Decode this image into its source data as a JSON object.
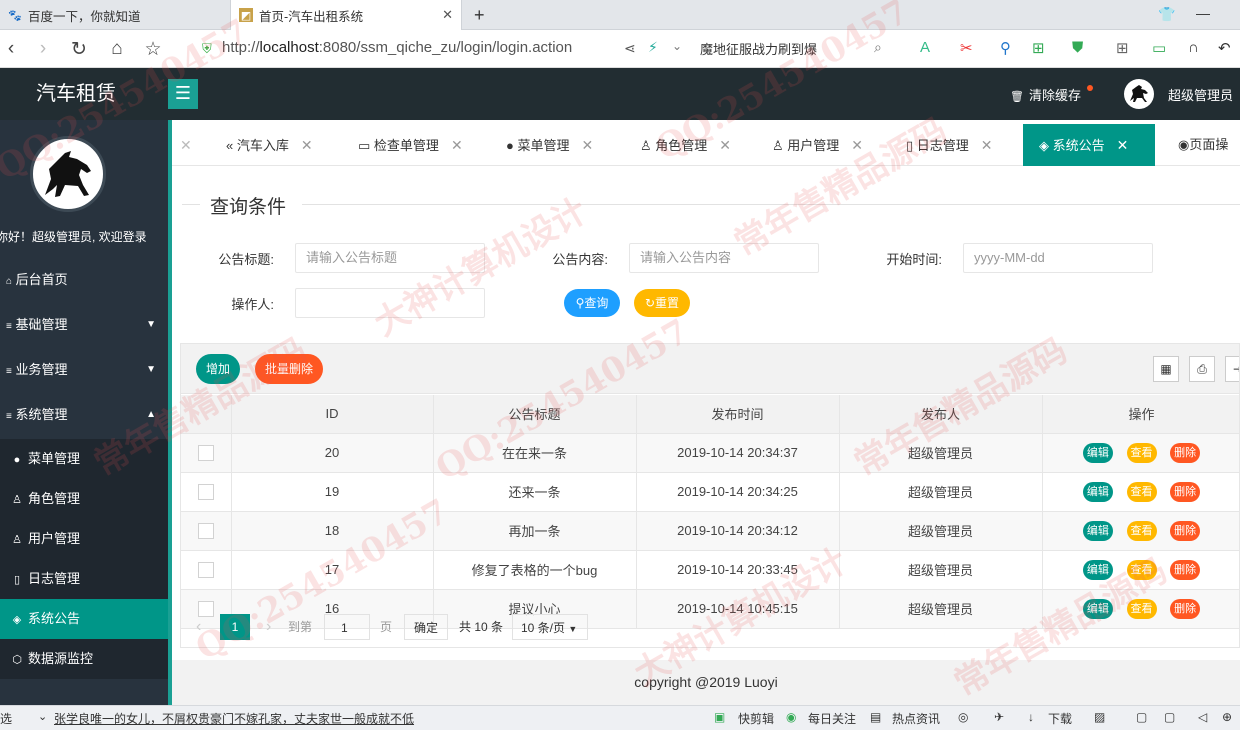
{
  "browser": {
    "tabs": [
      {
        "title": "百度一下，你就知道",
        "icon": "baidu-paw-icon"
      },
      {
        "title": "首页-汽车出租系统",
        "icon": "page-favicon-icon"
      }
    ],
    "new_tab": "+",
    "url_prefix": "http://",
    "url_host": "localhost",
    "url_rest": ":8080/ssm_qiche_zu/login/login.action",
    "search_text": "魔地征服战力刷到爆"
  },
  "header": {
    "brand": "汽车租赁",
    "menu_icon": "☰",
    "clear_cache": "清除缓存",
    "username": "超级管理员"
  },
  "sidebar": {
    "welcome": "你好！超级管理员, 欢迎登录",
    "items": [
      {
        "label": "后台首页",
        "icon": "home-icon"
      },
      {
        "label": "基础管理",
        "icon": "list-icon"
      },
      {
        "label": "业务管理",
        "icon": "list-icon"
      },
      {
        "label": "系统管理",
        "icon": "list-icon"
      }
    ],
    "sub_items": [
      {
        "label": "菜单管理",
        "icon": "●"
      },
      {
        "label": "角色管理",
        "icon": "♙"
      },
      {
        "label": "用户管理",
        "icon": "♙"
      },
      {
        "label": "日志管理",
        "icon": "▯"
      },
      {
        "label": "系统公告",
        "icon": "◈"
      },
      {
        "label": "数据源监控",
        "icon": "⬡"
      }
    ]
  },
  "page_tabs": [
    {
      "label": "汽车入库",
      "icon": "«"
    },
    {
      "label": "检查单管理",
      "icon": "▭"
    },
    {
      "label": "菜单管理",
      "icon": "●"
    },
    {
      "label": "角色管理",
      "icon": "♙"
    },
    {
      "label": "用户管理",
      "icon": "♙"
    },
    {
      "label": "日志管理",
      "icon": "▯"
    },
    {
      "label": "系统公告",
      "icon": "◈"
    },
    {
      "label": "页面操",
      "icon": "◉"
    }
  ],
  "query": {
    "title": "查询条件",
    "title_label": "公告标题:",
    "title_placeholder": "请输入公告标题",
    "content_label": "公告内容:",
    "content_placeholder": "请输入公告内容",
    "start_label": "开始时间:",
    "start_placeholder": "yyyy-MM-dd",
    "operator_label": "操作人:",
    "search_button": "查询",
    "reset_button": "重置"
  },
  "toolbar": {
    "add": "增加",
    "batch_delete": "批量删除"
  },
  "table": {
    "headers": [
      "ID",
      "公告标题",
      "发布时间",
      "发布人",
      "操作"
    ],
    "rows": [
      {
        "id": "20",
        "title": "在在来一条",
        "time": "2019-10-14 20:34:37",
        "author": "超级管理员"
      },
      {
        "id": "19",
        "title": "还来一条",
        "time": "2019-10-14 20:34:25",
        "author": "超级管理员"
      },
      {
        "id": "18",
        "title": "再加一条",
        "time": "2019-10-14 20:34:12",
        "author": "超级管理员"
      },
      {
        "id": "17",
        "title": "修复了表格的一个bug",
        "time": "2019-10-14 20:33:45",
        "author": "超级管理员"
      },
      {
        "id": "16",
        "title": "提议小心",
        "time": "2019-10-14 10:45:15",
        "author": "超级管理员"
      }
    ],
    "actions": {
      "edit": "编辑",
      "view": "查看",
      "delete": "删除"
    }
  },
  "pager": {
    "current": "1",
    "goto_label": "到第",
    "goto_value": "1",
    "page_unit": "页",
    "confirm": "确定",
    "total": "共 10 条",
    "page_size": "10 条/页"
  },
  "footer": "copyright @2019 Luoyi",
  "taskbar": {
    "left_text": "选",
    "news": "张学良唯一的女儿，不屑权贵豪门不嫁孔家，丈夫家世一般成就不低",
    "items": [
      "快剪辑",
      "每日关注",
      "热点资讯",
      "下载"
    ]
  },
  "watermarks": [
    "QQ:254540457",
    "大神计算机设计",
    "常年售精品源码"
  ],
  "colors": {
    "teal": "#009688",
    "dark": "#222d32",
    "sidebar": "#28333e",
    "orange": "#ff5722",
    "yellow": "#ffb800",
    "blue": "#1e9fff"
  }
}
